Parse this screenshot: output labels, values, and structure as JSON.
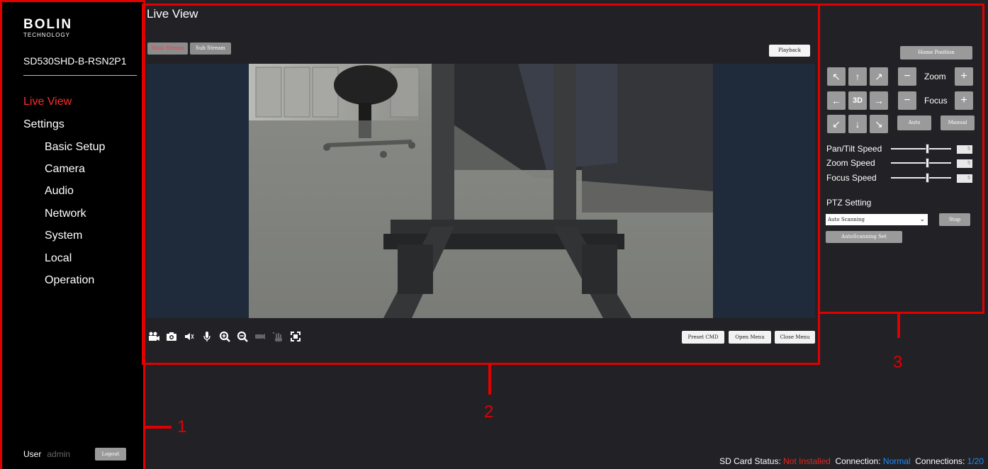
{
  "brand": {
    "logo_main": "BOLIN",
    "logo_sub": "TECHNOLOGY"
  },
  "device_name": "SD530SHD-B-RSN2P1",
  "nav": {
    "live_view": "Live View",
    "settings": "Settings",
    "items": [
      "Basic Setup",
      "Camera",
      "Audio",
      "Network",
      "System",
      "Local",
      "Operation"
    ]
  },
  "user": {
    "label": "User",
    "name": "admin",
    "logout": "Logout"
  },
  "main": {
    "title": "Live View",
    "main_stream": "Main Stream",
    "sub_stream": "Sub Stream",
    "playback": "Playback",
    "preset_cmd": "Preset CMD",
    "open_menu": "Open Menu",
    "close_menu": "Close Menu",
    "toolbar_icons": [
      "record-icon",
      "snapshot-icon",
      "speaker-icon",
      "microphone-icon",
      "zoom-in-icon",
      "zoom-out-icon",
      "ptz-icon",
      "hand-icon",
      "fullscreen-icon"
    ]
  },
  "ptz": {
    "home_position": "Home Position",
    "arrows": {
      "up_left": "↖",
      "up": "↑",
      "up_right": "↗",
      "left": "←",
      "center": "3D",
      "right": "→",
      "down_left": "↙",
      "down": "↓",
      "down_right": "↘"
    },
    "zoom_label": "Zoom",
    "focus_label": "Focus",
    "minus": "−",
    "plus": "+",
    "auto": "Auto",
    "manual": "Manual",
    "pan_tilt_speed": "Pan/Tilt Speed",
    "zoom_speed": "Zoom Speed",
    "focus_speed": "Focus Speed",
    "pan_tilt_value": "5",
    "zoom_value": "5",
    "focus_value": "5",
    "speed_level_fraction": 0.6,
    "ptz_setting": "PTZ Setting",
    "scan_mode": "Auto Scanning",
    "stop": "Stop",
    "autoscanning_set": "AutoScanning Set"
  },
  "status": {
    "sd_label": "SD Card Status:",
    "sd_value": "Not Installed",
    "conn_label": "Connection:",
    "conn_value": "Normal",
    "conns_label": "Connections:",
    "conns_value": "1/20"
  },
  "annotations": {
    "one": "1",
    "two": "2",
    "three": "3"
  },
  "colors": {
    "accent_red": "#ff2b2b",
    "annotation_red": "#e00000",
    "status_blue": "#1a8cff",
    "video_bg": "#1f2a3a"
  }
}
